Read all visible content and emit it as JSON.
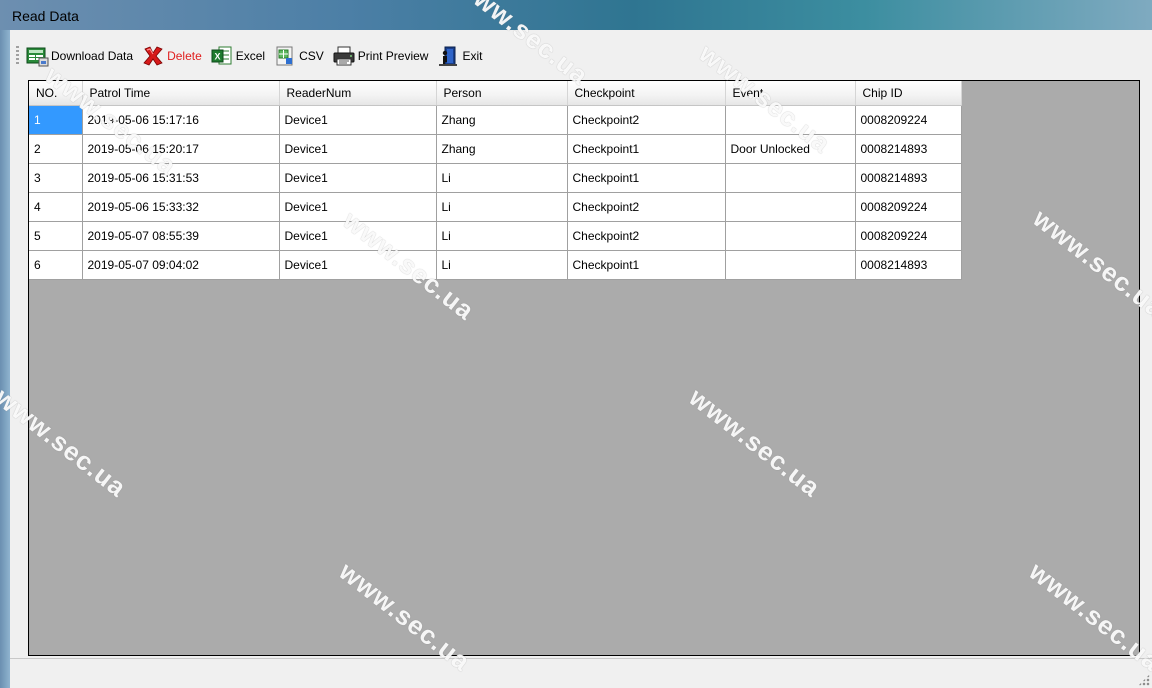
{
  "window": {
    "title": "Read Data"
  },
  "toolbar": {
    "buttons": [
      {
        "label": "Download Data",
        "icon": "download-data-icon"
      },
      {
        "label": "Delete",
        "icon": "delete-x-icon",
        "color": "#e02020"
      },
      {
        "label": "Excel",
        "icon": "excel-icon"
      },
      {
        "label": "CSV",
        "icon": "csv-icon"
      },
      {
        "label": "Print Preview",
        "icon": "printer-icon"
      },
      {
        "label": "Exit",
        "icon": "exit-door-icon"
      }
    ]
  },
  "grid": {
    "columns": [
      "NO.",
      "Patrol Time",
      "ReaderNum",
      "Person",
      "Checkpoint",
      "Event",
      "Chip ID"
    ],
    "rows": [
      [
        "1",
        "2019-05-06 15:17:16",
        "Device1",
        "Zhang",
        "Checkpoint2",
        "",
        "0008209224"
      ],
      [
        "2",
        "2019-05-06 15:20:17",
        "Device1",
        "Zhang",
        "Checkpoint1",
        "Door Unlocked",
        "0008214893"
      ],
      [
        "3",
        "2019-05-06 15:31:53",
        "Device1",
        "Li",
        "Checkpoint1",
        "",
        "0008214893"
      ],
      [
        "4",
        "2019-05-06 15:33:32",
        "Device1",
        "Li",
        "Checkpoint2",
        "",
        "0008209224"
      ],
      [
        "5",
        "2019-05-07 08:55:39",
        "Device1",
        "Li",
        "Checkpoint2",
        "",
        "0008209224"
      ],
      [
        "6",
        "2019-05-07 09:04:02",
        "Device1",
        "Li",
        "Checkpoint1",
        "",
        "0008214893"
      ]
    ],
    "selected_row": 0
  },
  "watermark": {
    "text": "www.sec.ua"
  },
  "colors": {
    "selection": "#3399ff",
    "grid_background": "#ababab",
    "delete_label": "#e02020"
  }
}
